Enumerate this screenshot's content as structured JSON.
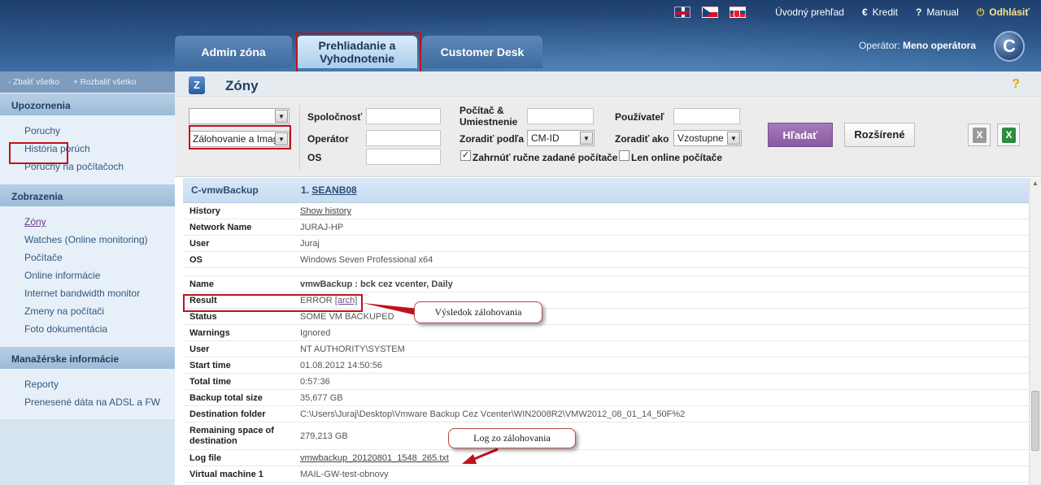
{
  "header": {
    "flags": [
      "uk-flag-icon",
      "cz-flag-icon",
      "sk-flag-icon"
    ],
    "links": {
      "overview": "Úvodný prehľad",
      "credit": "Kredit",
      "manual": "Manual",
      "logout": "Odhlásiť"
    },
    "tabs": [
      "Admin zóna",
      "Prehliadanie a Vyhodnotenie",
      "Customer Desk"
    ],
    "active_tab": "Prehliadanie a Vyhodnotenie",
    "operator_label": "Operátor:",
    "operator_name": "Meno operátora",
    "logo_letter": "C"
  },
  "sidebar": {
    "collapse_all": "- Zbaliť všetko",
    "expand_all": "+ Rozbaliť všetko",
    "sections": [
      {
        "title": "Upozornenia",
        "items": [
          "Poruchy",
          "História porúch",
          "Poruchy na počítačoch"
        ]
      },
      {
        "title": "Zobrazenia",
        "items": [
          "Zóny",
          "Watches (Online monitoring)",
          "Počítače",
          "Online informácie",
          "Internet bandwidth monitor",
          "Zmeny na počítači",
          "Foto dokumentácia"
        ]
      },
      {
        "title": "Manažérske informácie",
        "items": [
          "Reporty",
          "Prenesené dáta na ADSL a FW"
        ]
      }
    ],
    "active_item": "Zóny"
  },
  "page": {
    "title": "Zóny",
    "help": "?"
  },
  "filters": {
    "select1_value": "",
    "select2_value": "Zálohovanie a Image",
    "company_label": "Spoločnosť",
    "operator_label": "Operátor",
    "os_label": "OS",
    "computer_label": "Počítač & Umiestnenie",
    "sort_by_label": "Zoradiť podľa",
    "sort_by_value": "CM-ID",
    "include_label": "Zahrnúť ručne zadané počítače",
    "include_checked": true,
    "user_label": "Používateľ",
    "sort_order_label": "Zoradiť ako",
    "sort_order_value": "Vzostupne",
    "online_label": "Len online počítače",
    "online_checked": false,
    "search_button": "Hľadať",
    "advanced_button": "Rozšírené"
  },
  "detail": {
    "header_name": "C-vmwBackup",
    "header_index": "1.",
    "header_link": "SEANB08",
    "rows_top": [
      {
        "k": "History",
        "v": "Show history",
        "link": true
      },
      {
        "k": "Network Name",
        "v": "JURAJ-HP"
      },
      {
        "k": "User",
        "v": "Juraj"
      },
      {
        "k": "OS",
        "v": "Windows Seven Professional x64"
      }
    ],
    "rows_bottom": [
      {
        "k": "Name",
        "v": "vmwBackup : bck cez vcenter, Daily",
        "bold": true
      },
      {
        "k": "Result",
        "v": "ERROR ",
        "extra": "[arch]"
      },
      {
        "k": "Status",
        "v": "SOME VM BACKUPED"
      },
      {
        "k": "Warnings",
        "v": "Ignored"
      },
      {
        "k": "User",
        "v": "NT AUTHORITY\\SYSTEM"
      },
      {
        "k": "Start time",
        "v": "01.08.2012 14:50:56"
      },
      {
        "k": "Total time",
        "v": "0:57:36"
      },
      {
        "k": "Backup total size",
        "v": "35,677 GB"
      },
      {
        "k": "Destination folder",
        "v": "C:\\Users\\Juraj\\Desktop\\Vmware Backup Cez Vcenter\\WIN2008R2\\VMW2012_08_01_14_50F%2"
      },
      {
        "k": "Remaining space of destination",
        "v": "279,213 GB",
        "tall": true
      },
      {
        "k": "Log file",
        "v": "vmwbackup_20120801_1548_265.txt",
        "link": true
      },
      {
        "k": "Virtual machine 1",
        "v": "MAIL-GW-test-obnovy"
      }
    ]
  },
  "annotations": {
    "callout_result": "Výsledok zálohovania",
    "callout_log": "Log zo zálohovania",
    "highlight_color": "#c0121b"
  }
}
